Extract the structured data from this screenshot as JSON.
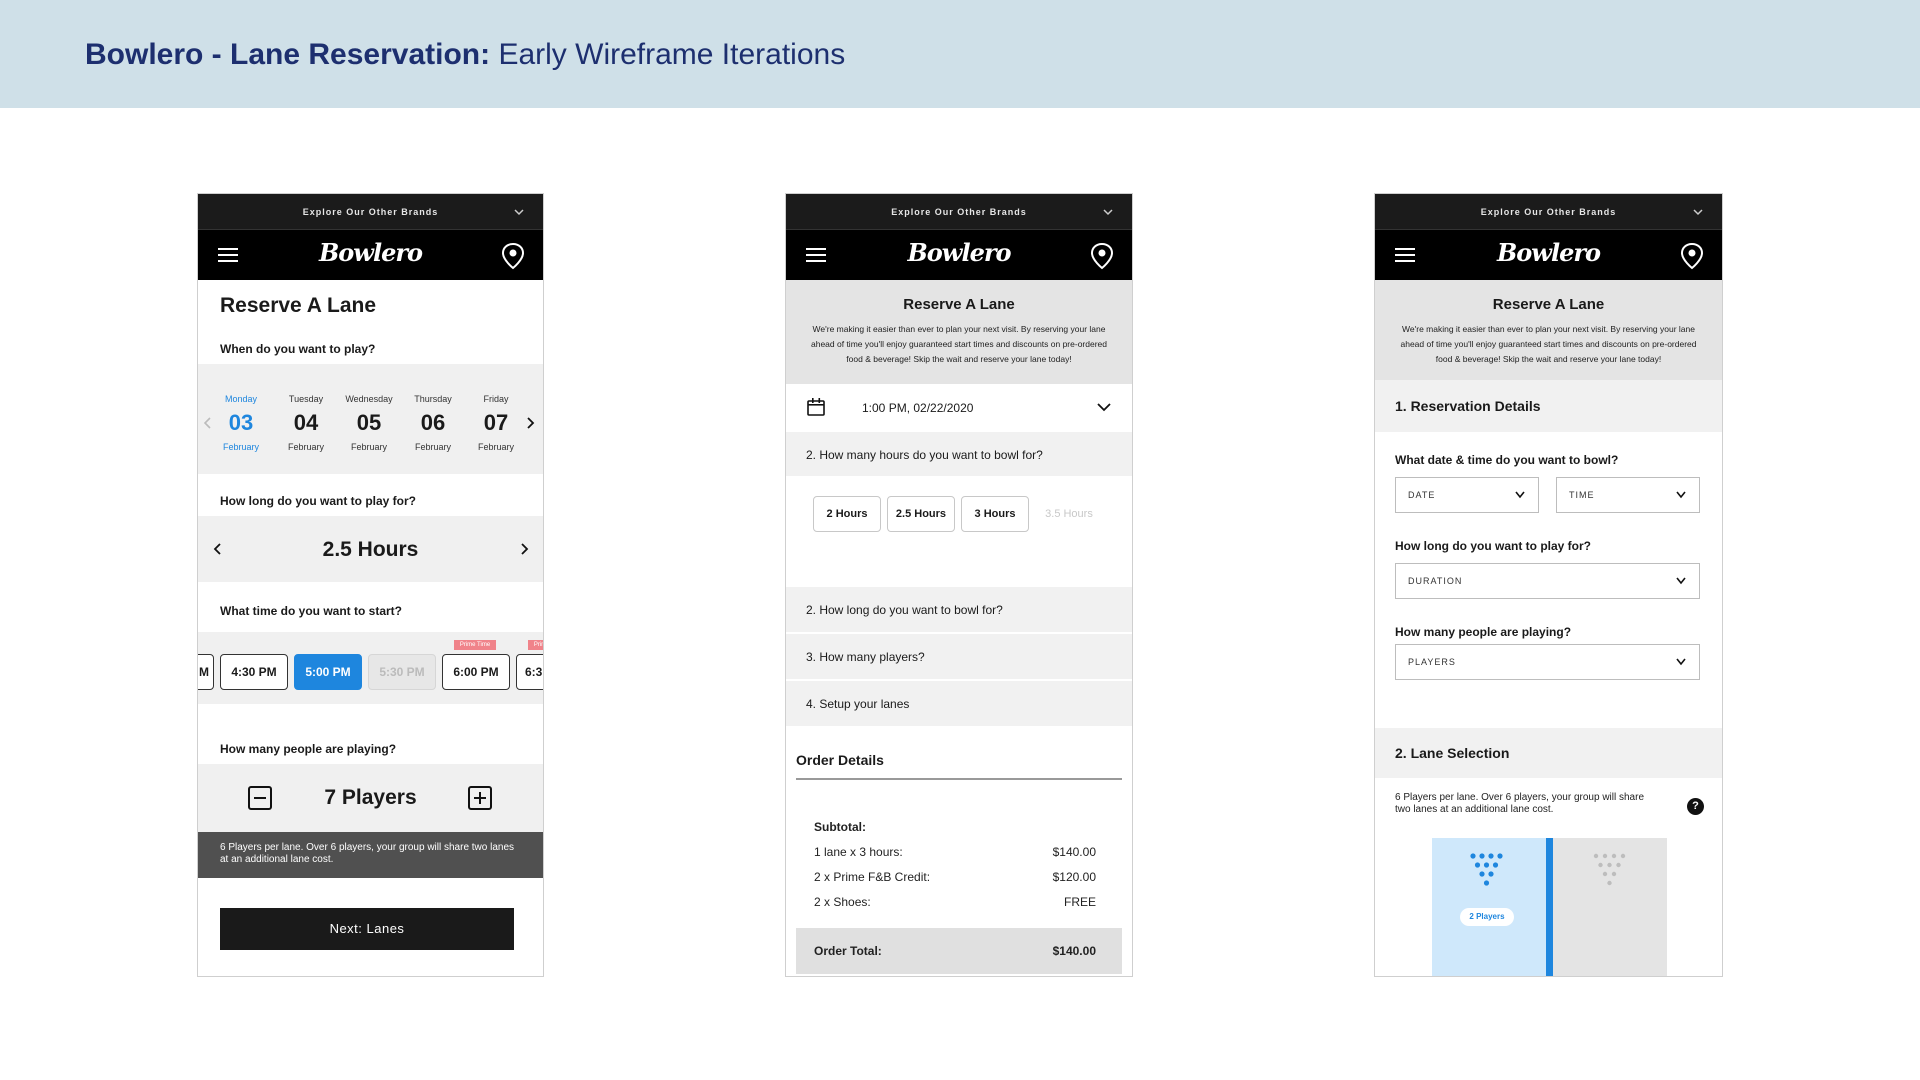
{
  "banner": {
    "title_bold": "Bowlero - Lane Reservation:",
    "title_rest": "Early Wireframe Iterations"
  },
  "common": {
    "brands": "Explore Our Other Brands",
    "logo": "Bowlero"
  },
  "p1": {
    "title": "Reserve A Lane",
    "q_when": "When do you want to play?",
    "days": [
      {
        "name": "Monday",
        "date": "03",
        "month": "February"
      },
      {
        "name": "Tuesday",
        "date": "04",
        "month": "February"
      },
      {
        "name": "Wednesday",
        "date": "05",
        "month": "February"
      },
      {
        "name": "Thursday",
        "date": "06",
        "month": "February"
      },
      {
        "name": "Friday",
        "date": "07",
        "month": "February"
      }
    ],
    "q_long": "How long do you want to play for?",
    "duration": "2.5 Hours",
    "q_time": "What time do you want to start?",
    "times": [
      "M",
      "4:30 PM",
      "5:00 PM",
      "5:30 PM",
      "6:00 PM",
      "6:3"
    ],
    "tag": "Prime Time",
    "q_people": "How many people are playing?",
    "players": "7 Players",
    "note": "6 Players per lane. Over 6 players, your group will share two lanes at an additional lane cost.",
    "next": "Next: Lanes"
  },
  "p2": {
    "title": "Reserve A Lane",
    "intro": "We're making it easier than ever to plan your next visit. By reserving your lane ahead of time you'll enjoy guaranteed start times and discounts on pre-ordered food & beverage! Skip the wait and reserve your lane today!",
    "datetime": "1:00 PM, 02/22/2020",
    "q_hours": "2. How many hours do you want to bowl for?",
    "hours": [
      "2 Hours",
      "2.5 Hours",
      "3 Hours",
      "3.5 Hours"
    ],
    "rows": [
      "2. How long do you want to bowl for?",
      "3. How many players?",
      "4. Setup your lanes"
    ],
    "order_title": "Order Details",
    "subtotal": "Subtotal:",
    "lines": [
      {
        "label": "1 lane x 3 hours:",
        "value": "$140.00"
      },
      {
        "label": "2 x Prime F&B Credit:",
        "value": "$120.00"
      },
      {
        "label": "2 x Shoes:",
        "value": "FREE"
      }
    ],
    "total_label": "Order Total:",
    "total_value": "$140.00"
  },
  "p3": {
    "title": "Reserve A Lane",
    "intro": "We're making it easier than ever to plan your next visit. By reserving your lane ahead of time you'll enjoy guaranteed start times and discounts on pre-ordered food & beverage! Skip the wait and reserve your lane today!",
    "section1": "1. Reservation Details",
    "q_date": "What date & time do you want to bowl?",
    "date_ph": "DATE",
    "time_ph": "TIME",
    "q_long": "How long do you want to play for?",
    "duration_ph": "DURATION",
    "q_people": "How many people are playing?",
    "players_ph": "PLAYERS",
    "section2": "2. Lane Selection",
    "lane_note": "6 Players per lane. Over 6 players, your group will share two lanes at an additional lane cost.",
    "lane_badge": "2 Players",
    "help": "?"
  },
  "colors": {
    "accent": "#1e86de",
    "banner_bg": "#cfe0e8",
    "banner_text": "#1d2f6f",
    "prime_tag": "#f0838a"
  }
}
